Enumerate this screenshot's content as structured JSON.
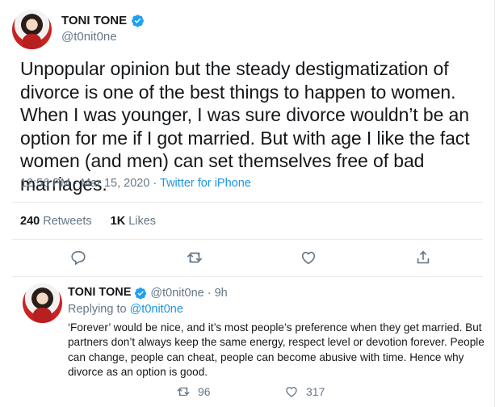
{
  "main_tweet": {
    "display_name": "TONI TONE",
    "handle": "@t0nit0ne",
    "text": "Unpopular opinion but the steady destigmatization of divorce is one of the best things to happen to women. When I was younger, I was sure divorce wouldn’t be an option for me if I got married. But with age I like the fact women (and men) can set themselves free of bad marriages.",
    "timestamp": "12:56 PM · Mar 15, 2020 · ",
    "source": "Twitter for iPhone",
    "retweets_count": "240",
    "retweets_label": "Retweets",
    "likes_count": "1K",
    "likes_label": "Likes"
  },
  "reply_tweet": {
    "display_name": "TONI TONE",
    "handle": "@t0nit0ne",
    "time": "· 9h",
    "replying_prefix": "Replying to ",
    "replying_handle": "@t0nit0ne",
    "text": "‘Forever’ would be nice, and it’s most people’s preference when they get married. But partners don’t always keep the same energy, respect level or devotion forever. People can change, people can cheat, people can become abusive with time. Hence why divorce as an option is good.",
    "retweets": "96",
    "likes": "317"
  },
  "colors": {
    "verified": "#1da1f2",
    "link": "#1b95e0",
    "secondary_text": "#657786",
    "divider": "#e6ecf0"
  },
  "icons": [
    "verified-badge-icon",
    "reply-icon",
    "retweet-icon",
    "like-icon",
    "share-icon"
  ]
}
